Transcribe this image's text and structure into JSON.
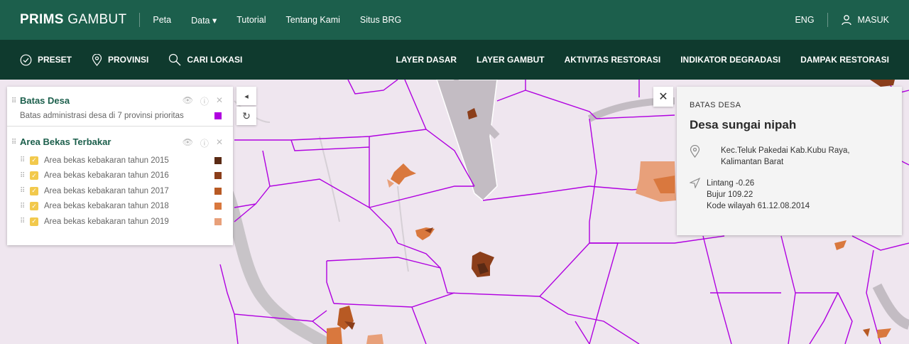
{
  "app": {
    "logo_bold": "PRIMS",
    "logo_rest": "GAMBUT"
  },
  "topnav": {
    "items": [
      {
        "label": "Peta",
        "active": true
      },
      {
        "label": "Data ▾"
      },
      {
        "label": "Tutorial"
      },
      {
        "label": "Tentang Kami"
      },
      {
        "label": "Situs BRG"
      }
    ],
    "lang": "ENG",
    "login": "MASUK"
  },
  "subnav": {
    "left": [
      {
        "label": "PRESET",
        "icon": "check-circle-icon"
      },
      {
        "label": "PROVINSI",
        "icon": "map-pin-icon"
      },
      {
        "label": "CARI LOKASI",
        "icon": "search-icon"
      }
    ],
    "right": [
      "LAYER DASAR",
      "LAYER GAMBUT",
      "AKTIVITAS RESTORASI",
      "INDIKATOR DEGRADASI",
      "DAMPAK RESTORASI"
    ]
  },
  "legend": {
    "batas_desa": {
      "title": "Batas Desa",
      "description": "Batas administrasi desa di 7 provinsi prioritas",
      "color": "#b000e0"
    },
    "area_bekas": {
      "title": "Area Bekas Terbakar",
      "items": [
        {
          "label": "Area bekas kebakaran tahun 2015",
          "color": "#5a2a14",
          "checked": true
        },
        {
          "label": "Area bekas kebakaran tahun 2016",
          "color": "#8b3e1a",
          "checked": true
        },
        {
          "label": "Area bekas kebakaran tahun 2017",
          "color": "#b85a24",
          "checked": true
        },
        {
          "label": "Area bekas kebakaran tahun 2018",
          "color": "#d9783e",
          "checked": true
        },
        {
          "label": "Area bekas kebakaran tahun 2019",
          "color": "#e8a07a",
          "checked": true
        }
      ]
    }
  },
  "controls": {
    "collapse": "◂",
    "refresh": "↻"
  },
  "info": {
    "kicker": "BATAS DESA",
    "title": "Desa sungai nipah",
    "address": "Kec.Teluk Pakedai Kab.Kubu Raya, Kalimantan Barat",
    "lintang": "Lintang -0.26",
    "bujur": "Bujur 109.22",
    "kode": "Kode wilayah 61.12.08.2014"
  },
  "colors": {
    "topbar": "#1c5f4c",
    "subbar": "#0f3a2e",
    "accent": "#f2c94c",
    "boundary": "#b000e0",
    "map_fill": "#efe6ef"
  }
}
